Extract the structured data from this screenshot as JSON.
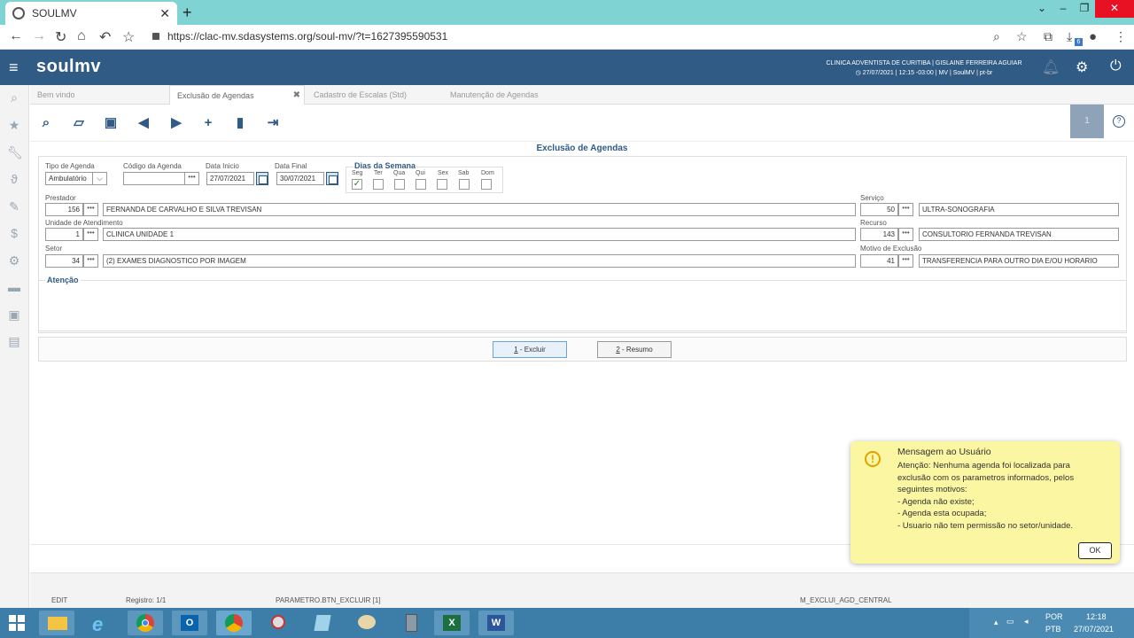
{
  "browser": {
    "tab_title": "SOULMV",
    "tab_close": "✕",
    "new_tab": "+",
    "url": "https://clac-mv.sdasystems.org/soul-mv/?t=1627395590531",
    "extension_badge": "6"
  },
  "app": {
    "logo": "soulmv",
    "header_line1": "CLINICA ADVENTISTA DE CURITIBA | GISLAINE FERREIRA AGUIAR",
    "header_line2": "27/07/2021 | 12:15 -03:00 | MV | SoulMV | pt-br"
  },
  "tabs": [
    {
      "label": "Bem vindo"
    },
    {
      "label": "Exclusão de Agendas",
      "close": "✖"
    },
    {
      "label": "Cadastro de Escalas (Std)"
    },
    {
      "label": "Manutenção de Agendas"
    }
  ],
  "toolbar": {
    "page_number": "1"
  },
  "form": {
    "title": "Exclusão de Agendas",
    "tipo_agenda": {
      "label": "Tipo de Agenda",
      "value": "Ambulatório"
    },
    "codigo_agenda": {
      "label": "Código da Agenda",
      "value": ""
    },
    "data_inicio": {
      "label": "Data Inicio",
      "value": "27/07/2021"
    },
    "data_final": {
      "label": "Data Final",
      "value": "30/07/2021"
    },
    "dias_semana": {
      "title": "Dias da Semana",
      "days": [
        {
          "label": "Seg",
          "checked": true
        },
        {
          "label": "Ter",
          "checked": false
        },
        {
          "label": "Qua",
          "checked": false
        },
        {
          "label": "Qui",
          "checked": false
        },
        {
          "label": "Sex",
          "checked": false
        },
        {
          "label": "Sab",
          "checked": false
        },
        {
          "label": "Dom",
          "checked": false
        }
      ]
    },
    "prestador": {
      "label": "Prestador",
      "code": "156",
      "name": "FERNANDA DE CARVALHO E SILVA TREVISAN"
    },
    "servico": {
      "label": "Serviço",
      "code": "50",
      "name": "ULTRA-SONOGRAFIA"
    },
    "unidade": {
      "label": "Unidade de Atendimento",
      "code": "1",
      "name": "CLINICA UNIDADE 1"
    },
    "recurso": {
      "label": "Recurso",
      "code": "143",
      "name": "CONSULTORIO FERNANDA TREVISAN"
    },
    "setor": {
      "label": "Setor",
      "code": "34",
      "name": "(2) EXAMES DIAGNOSTICO POR IMAGEM"
    },
    "motivo": {
      "label": "Motivo de Exclusão",
      "code": "41",
      "name": "TRANSFERENCIA PARA OUTRO DIA E/OU HORARIO"
    },
    "atencao_label": "Atenção",
    "lookup_dots": "•••",
    "btn_excluir_key": "1",
    "btn_excluir": " - Excluir",
    "btn_resumo_key": "2",
    "btn_resumo": " - Resumo"
  },
  "status": {
    "mode": "EDIT",
    "registro": "Registro: 1/1",
    "parametro": "PARAMETRO.BTN_EXCLUIR [1]",
    "module": "M_EXCLUI_AGD_CENTRAL"
  },
  "popup": {
    "title": "Mensagem ao Usuário",
    "lines": [
      "Atenção: Nenhuma agenda foi localizada para",
      "exclusão com os parametros informados, pelos",
      "seguintes motivos:",
      "- Agenda não existe;",
      "- Agenda esta ocupada;",
      "- Usuario não tem permissão no setor/unidade."
    ],
    "ok": "OK"
  },
  "taskbar": {
    "lang1": "POR",
    "lang2": "PTB",
    "time": "12:18",
    "date": "27/07/2021"
  },
  "colors": {
    "header": "#2f5b85",
    "accent": "#2f5b85",
    "popup_bg": "#fbf6a2",
    "taskbar": "#3d7ea8"
  }
}
